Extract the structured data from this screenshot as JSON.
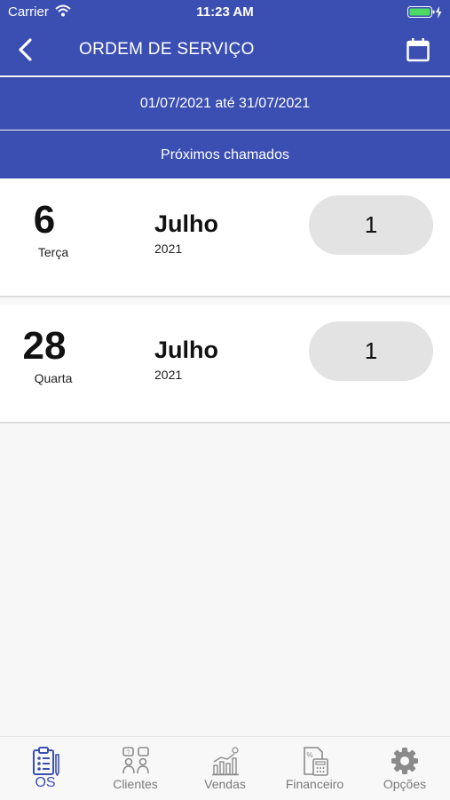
{
  "status_bar": {
    "carrier": "Carrier",
    "time": "11:23 AM"
  },
  "nav": {
    "title": "ORDEM DE SERVIÇO",
    "back_icon": "chevron-left-icon",
    "calendar_icon": "calendar-icon"
  },
  "date_range": "01/07/2021 até 31/07/2021",
  "section_title": "Próximos chamados",
  "entries": [
    {
      "day": "6",
      "weekday": "Terça",
      "month": "Julho",
      "year": "2021",
      "count": "1"
    },
    {
      "day": "28",
      "weekday": "Quarta",
      "month": "Julho",
      "year": "2021",
      "count": "1"
    }
  ],
  "tabs": [
    {
      "label": "OS",
      "icon": "clipboard-icon",
      "active": true
    },
    {
      "label": "Clientes",
      "icon": "clients-icon",
      "active": false
    },
    {
      "label": "Vendas",
      "icon": "sales-chart-icon",
      "active": false
    },
    {
      "label": "Financeiro",
      "icon": "calculator-icon",
      "active": false
    },
    {
      "label": "Opções",
      "icon": "gear-icon",
      "active": false
    }
  ],
  "colors": {
    "primary": "#3b4fb3",
    "pill": "#e3e3e3",
    "tab_inactive": "#7a7a7a"
  }
}
